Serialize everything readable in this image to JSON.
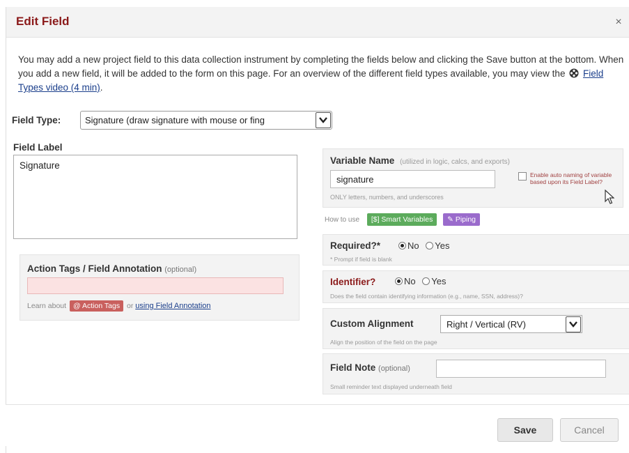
{
  "dialog": {
    "title": "Edit Field",
    "close_symbol": "×"
  },
  "intro": {
    "text": "You may add a new project field to this data collection instrument by completing the fields below and clicking the Save button at the bottom. When you add a new field, it will be added to the form on this page. For an overview of the different field types available, you may view the",
    "video_link": "Field Types video (4 min)",
    "after_link": "."
  },
  "field_type": {
    "label": "Field Type:",
    "selected": "Signature (draw signature with mouse or fing"
  },
  "field_label": {
    "title": "Field Label",
    "value": "Signature"
  },
  "action_tags": {
    "title": "Action Tags / Field Annotation",
    "optional": "(optional)",
    "value": "",
    "learn_prefix": "Learn about",
    "badge": "@ Action Tags",
    "or_text": "or",
    "annotation_link": "using Field Annotation"
  },
  "variable": {
    "title": "Variable Name",
    "note": "(utilized in logic, calcs, and exports)",
    "value": "signature",
    "hint": "ONLY letters, numbers, and underscores",
    "auto_naming": "Enable auto naming of variable based upon its Field Label?"
  },
  "howto": {
    "label": "How to use",
    "smart_variables": "[$] Smart Variables",
    "piping": "Piping"
  },
  "required": {
    "title": "Required?*",
    "no": "No",
    "yes": "Yes",
    "selected": "No",
    "hint": "* Prompt if field is blank"
  },
  "identifier": {
    "title": "Identifier?",
    "no": "No",
    "yes": "Yes",
    "selected": "No",
    "hint": "Does the field contain identifying information (e.g., name, SSN, address)?"
  },
  "alignment": {
    "title": "Custom Alignment",
    "selected": "Right / Vertical (RV)",
    "hint": "Align the position of the field on the page"
  },
  "field_note": {
    "title": "Field Note",
    "optional": "(optional)",
    "value": "",
    "hint": "Small reminder text displayed underneath field"
  },
  "footer": {
    "save": "Save",
    "cancel": "Cancel"
  },
  "colors": {
    "title_red": "#8b1a1a",
    "panel_bg": "#f3f3f3",
    "action_tag_badge": "#c9605e",
    "smart_variables_badge": "#5cab5c",
    "piping_badge": "#9a6bcc"
  }
}
